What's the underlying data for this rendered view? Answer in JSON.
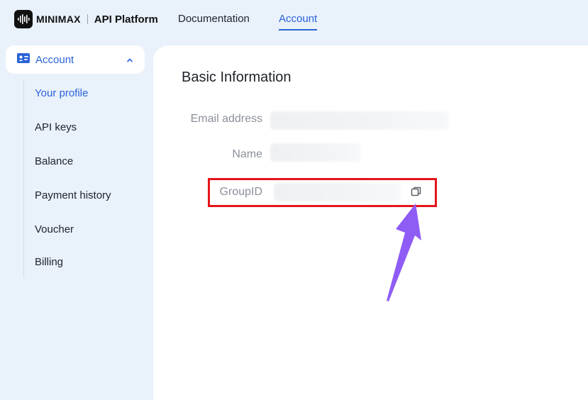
{
  "brand": {
    "name": "MINIMAX",
    "product": "API Platform"
  },
  "nav": {
    "documentation": "Documentation",
    "account": "Account"
  },
  "sidebar": {
    "group_label": "Account",
    "items": [
      {
        "label": "Your profile",
        "active": true
      },
      {
        "label": "API keys"
      },
      {
        "label": "Balance"
      },
      {
        "label": "Payment history"
      },
      {
        "label": "Voucher"
      },
      {
        "label": "Billing"
      }
    ]
  },
  "main": {
    "title": "Basic Information",
    "fields": {
      "email_label": "Email address",
      "name_label": "Name",
      "group_id_label": "GroupID"
    }
  },
  "colors": {
    "accent": "#2a63d9",
    "highlight": "#e4141b",
    "arrow": "#8f5cf5",
    "background": "#e9f1fb"
  },
  "icons": [
    "minimax-logo-icon",
    "id-card-icon",
    "chevron-up-icon",
    "copy-icon",
    "pointer-arrow-icon"
  ]
}
